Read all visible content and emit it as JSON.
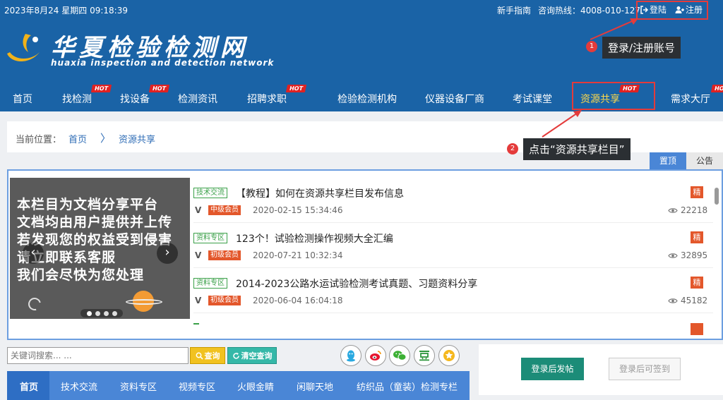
{
  "topbar": {
    "date": "2023年8月24 星期四 09:18:39",
    "guide": "新手指南",
    "hotline": "咨询热线：4008-010-127",
    "login": "登陆",
    "register": "注册"
  },
  "logo": {
    "title": "华夏检验检测网",
    "subtitle": "huaxia inspection and detection network"
  },
  "annotations": {
    "step1_number": "1",
    "step1_text": "登录/注册账号",
    "step2_number": "2",
    "step2_text": "点击“资源共享栏目”"
  },
  "nav": {
    "items": [
      {
        "label": "首页",
        "hot": ""
      },
      {
        "label": "找检测",
        "hot": "HOT"
      },
      {
        "label": "找设备",
        "hot": "HOT"
      },
      {
        "label": "检测资讯",
        "hot": ""
      },
      {
        "label": "招聘求职",
        "hot": "HOT"
      },
      {
        "label": "检验检测机构",
        "hot": ""
      },
      {
        "label": "仪器设备厂商",
        "hot": ""
      },
      {
        "label": "考试课堂",
        "hot": ""
      },
      {
        "label": "资源共享",
        "hot": "HOT"
      },
      {
        "label": "需求大厅",
        "hot": "HOT"
      }
    ]
  },
  "breadcrumb": {
    "label": "当前位置：",
    "home": "首页",
    "separator": "〉",
    "current": "资源共享"
  },
  "panel_tabs": {
    "top": "置顶",
    "notice": "公告"
  },
  "slider": {
    "lines": [
      "本栏目为文档分享平台",
      "文档均由用户提供并上传",
      "若发现您的权益受到侵害",
      "请立即联系客服",
      "我们会尽快为您处理"
    ],
    "prev": "‹",
    "next": "›"
  },
  "posts": [
    {
      "category": "技术交流",
      "title": "【教程】如何在资源共享栏目发布信息",
      "v": "V",
      "level": "中级会员",
      "time": "2020-02-15 15:34:46",
      "badge": "精",
      "views": "22218"
    },
    {
      "category": "资料专区",
      "title": "123个！试验检测操作视频大全汇编",
      "v": "V",
      "level": "初级会员",
      "time": "2020-07-21 10:32:34",
      "badge": "精",
      "views": "32895"
    },
    {
      "category": "资料专区",
      "title": "2014-2023公路水运试验检测考试真题、习题资料分享",
      "v": "V",
      "level": "初级会员",
      "time": "2020-06-04 16:04:18",
      "badge": "精",
      "views": "45182"
    }
  ],
  "search": {
    "placeholder": "关键词搜索... ...",
    "query_button": "查询",
    "clear_button": "清空查询"
  },
  "subnav": {
    "items": [
      "首页",
      "技术交流",
      "资料专区",
      "视频专区",
      "火眼金睛",
      "闲聊天地",
      "纺织品（童装）检测专栏"
    ]
  },
  "side": {
    "post_button": "登录后发帖",
    "sign_button": "登录后可签到"
  },
  "colors": {
    "header_blue": "#1a63a6",
    "accent_red": "#e43b3b",
    "hot_red": "#e02222",
    "panel_blue": "#4a86d6",
    "active_yellow": "#ffd84a",
    "green_button": "#1c8c78"
  }
}
